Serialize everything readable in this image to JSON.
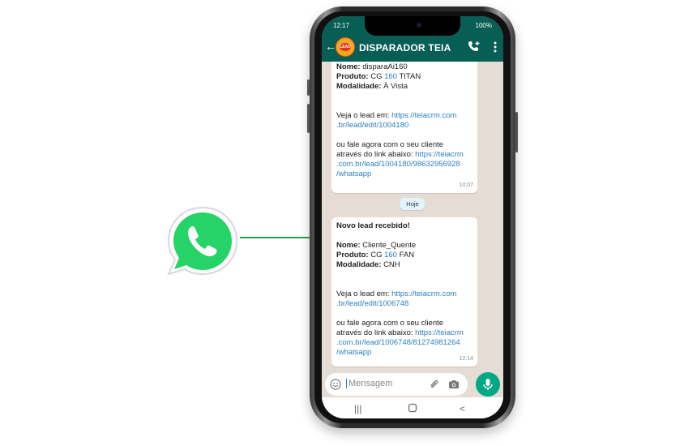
{
  "status_bar": {
    "time": "12:17",
    "battery": "100%"
  },
  "chat_header": {
    "title": "DISPARADOR TEIA",
    "avatar_text": "LEAD"
  },
  "messages": [
    {
      "lines": [
        {
          "label": "Nome:",
          "value": "disparaAi160"
        },
        {
          "label": "Produto:",
          "value_pre": "CG",
          "value_hl": "160",
          "value_post": "TITAN"
        },
        {
          "label": "Modalidade:",
          "value": "À Vista"
        }
      ],
      "link_intro": "Veja o lead em:",
      "link1_a": "https://teiacrm.com",
      "link1_b": ".br/lead/edit/1004180",
      "contact_a": "ou fale agora com o seu cliente",
      "contact_b": "através do link abaixo:",
      "link2_a": "https://teiacrm",
      "link2_b": ".com.br/lead/1004180/98632956928",
      "link2_c": "/whatsapp",
      "time": "10:07"
    },
    {
      "header": "Novo lead recebido!",
      "lines": [
        {
          "label": "Nome:",
          "value": "Cliente_Quente"
        },
        {
          "label": "Produto:",
          "value_pre": "CG",
          "value_hl": "160",
          "value_post": "FAN"
        },
        {
          "label": "Modalidade:",
          "value": "CNH"
        }
      ],
      "link_intro": "Veja o lead em:",
      "link1_a": "https://teiacrm.com",
      "link1_b": ".br/lead/edit/1006748",
      "contact_a": "ou fale agora com o seu cliente",
      "contact_b": "através do link abaixo:",
      "link2_a": "https://teiacrm",
      "link2_b": ".com.br/lead/1006748/81274981264",
      "link2_c": "/whatsapp",
      "time": "12:14"
    }
  ],
  "day_separator": "Hoje",
  "composer": {
    "placeholder": "Mensagem"
  },
  "colors": {
    "header": "#075e54",
    "mic": "#00a884",
    "link": "#2a7fc1",
    "chat_bg": "#e5ddd5",
    "whatsapp_green": "#25d366"
  },
  "icons": [
    "whatsapp-logo-icon",
    "back-arrow-icon",
    "add-call-icon",
    "more-vert-icon",
    "emoji-icon",
    "attach-icon",
    "camera-icon",
    "mic-icon"
  ]
}
